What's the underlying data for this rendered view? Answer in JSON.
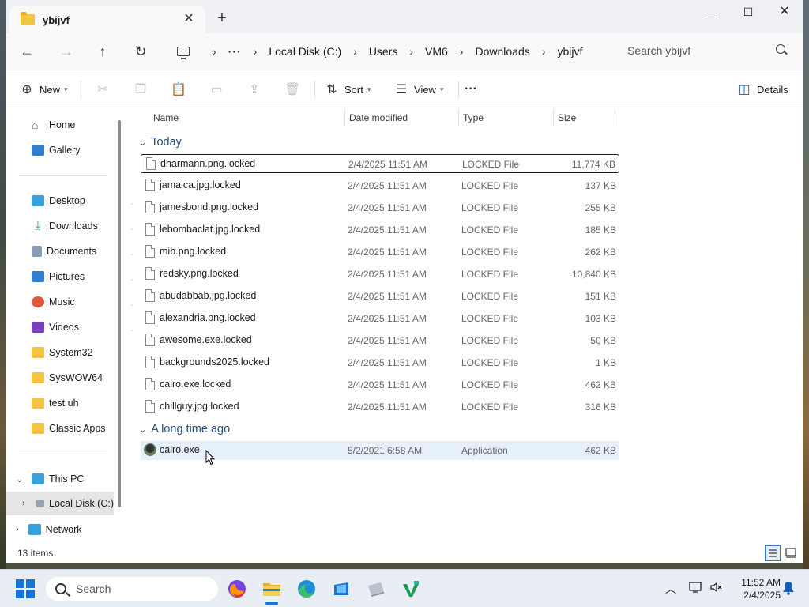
{
  "window": {
    "tab_title": "ybijvf",
    "tab_close_glyph": "✕",
    "new_tab_glyph": "+",
    "controls": {
      "minimize": "—",
      "maximize": "☐",
      "close": "✕"
    }
  },
  "nav": {
    "back": "←",
    "forward": "→",
    "up": "↑",
    "refresh": "↻",
    "overflow": "···",
    "breadcrumbs": [
      "Local Disk (C:)",
      "Users",
      "VM6",
      "Downloads",
      "ybijvf"
    ],
    "separator": "›"
  },
  "search": {
    "placeholder": "Search ybijvf"
  },
  "toolbar": {
    "new_label": "New",
    "sort_label": "Sort",
    "view_label": "View",
    "more_label": "···",
    "details_label": "Details"
  },
  "sidebar": {
    "home": "Home",
    "gallery": "Gallery",
    "quick": [
      {
        "label": "Desktop",
        "pinned": true
      },
      {
        "label": "Downloads",
        "pinned": true
      },
      {
        "label": "Documents",
        "pinned": true
      },
      {
        "label": "Pictures",
        "pinned": true
      },
      {
        "label": "Music",
        "pinned": true
      },
      {
        "label": "Videos",
        "pinned": true
      },
      {
        "label": "System32",
        "pinned": false
      },
      {
        "label": "SysWOW64",
        "pinned": false
      },
      {
        "label": "test uh",
        "pinned": false
      },
      {
        "label": "Classic Apps",
        "pinned": false
      }
    ],
    "this_pc": "This PC",
    "local_disk": "Local Disk (C:)",
    "network": "Network",
    "pin_glyph": "📌"
  },
  "columns": {
    "name": "Name",
    "date": "Date modified",
    "type": "Type",
    "size": "Size"
  },
  "groups": [
    {
      "label": "Today",
      "files": [
        {
          "name": "dharmann.png.locked",
          "date": "2/4/2025 11:51 AM",
          "type": "LOCKED File",
          "size": "11,774 KB"
        },
        {
          "name": "jamaica.jpg.locked",
          "date": "2/4/2025 11:51 AM",
          "type": "LOCKED File",
          "size": "137 KB"
        },
        {
          "name": "jamesbond.png.locked",
          "date": "2/4/2025 11:51 AM",
          "type": "LOCKED File",
          "size": "255 KB"
        },
        {
          "name": "lebombaclat.jpg.locked",
          "date": "2/4/2025 11:51 AM",
          "type": "LOCKED File",
          "size": "185 KB"
        },
        {
          "name": "mib.png.locked",
          "date": "2/4/2025 11:51 AM",
          "type": "LOCKED File",
          "size": "262 KB"
        },
        {
          "name": "redsky.png.locked",
          "date": "2/4/2025 11:51 AM",
          "type": "LOCKED File",
          "size": "10,840 KB"
        },
        {
          "name": "abudabbab.jpg.locked",
          "date": "2/4/2025 11:51 AM",
          "type": "LOCKED File",
          "size": "151 KB"
        },
        {
          "name": "alexandria.png.locked",
          "date": "2/4/2025 11:51 AM",
          "type": "LOCKED File",
          "size": "103 KB"
        },
        {
          "name": "awesome.exe.locked",
          "date": "2/4/2025 11:51 AM",
          "type": "LOCKED File",
          "size": "50 KB"
        },
        {
          "name": "backgrounds2025.locked",
          "date": "2/4/2025 11:51 AM",
          "type": "LOCKED File",
          "size": "1 KB"
        },
        {
          "name": "cairo.exe.locked",
          "date": "2/4/2025 11:51 AM",
          "type": "LOCKED File",
          "size": "462 KB"
        },
        {
          "name": "chillguy.jpg.locked",
          "date": "2/4/2025 11:51 AM",
          "type": "LOCKED File",
          "size": "316 KB"
        }
      ]
    },
    {
      "label": "A long time ago",
      "files": [
        {
          "name": "cairo.exe",
          "date": "5/2/2021 6:58 AM",
          "type": "Application",
          "size": "462 KB"
        }
      ]
    }
  ],
  "status": {
    "item_count": "13 items"
  },
  "taskbar": {
    "search_label": "Search",
    "time": "11:52 AM",
    "date": "2/4/2025",
    "chevron": "︿"
  },
  "colors": {
    "accent": "#1a73d9",
    "hover_row": "#e5f0fb",
    "group_header": "#2b4b7a"
  }
}
